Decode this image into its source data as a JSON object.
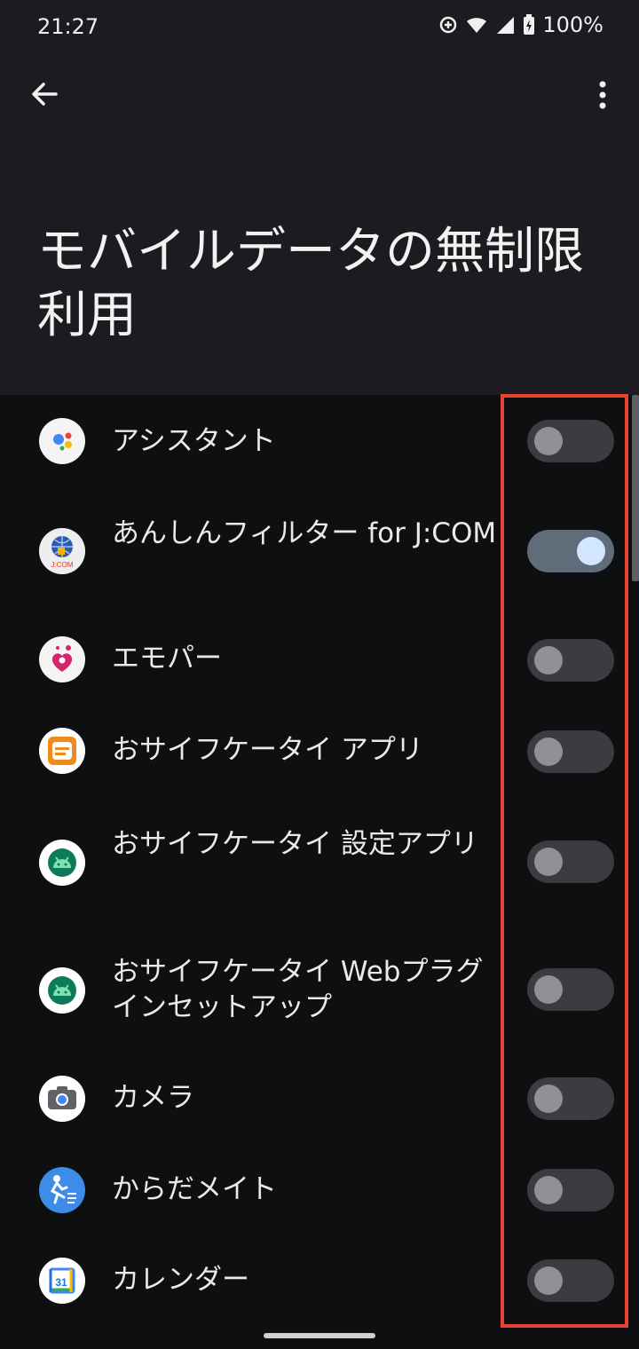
{
  "status_bar": {
    "time": "21:27",
    "battery": "100%"
  },
  "title": "モバイルデータの無制限利用",
  "apps": [
    {
      "label": "アシスタント",
      "icon": "google-assistant-icon",
      "enabled": false
    },
    {
      "label": "あんしんフィルター for J:COM",
      "icon": "anshin-filter-icon",
      "enabled": true
    },
    {
      "label": "エモパー",
      "icon": "emopa-icon",
      "enabled": false
    },
    {
      "label": "おサイフケータイ アプリ",
      "icon": "osaifu-keitai-icon",
      "enabled": false
    },
    {
      "label": "おサイフケータイ 設定アプリ",
      "icon": "android-icon",
      "enabled": false
    },
    {
      "label": "おサイフケータイ Webプラグインセットアップ",
      "icon": "android-icon",
      "enabled": false
    },
    {
      "label": "カメラ",
      "icon": "camera-icon",
      "enabled": false
    },
    {
      "label": "からだメイト",
      "icon": "karada-mate-icon",
      "enabled": false
    },
    {
      "label": "カレンダー",
      "icon": "calendar-icon",
      "enabled": false
    }
  ],
  "calendar_icon_text": "31",
  "colors": {
    "accent": "#d2e6ff",
    "highlight": "#e8432e"
  }
}
